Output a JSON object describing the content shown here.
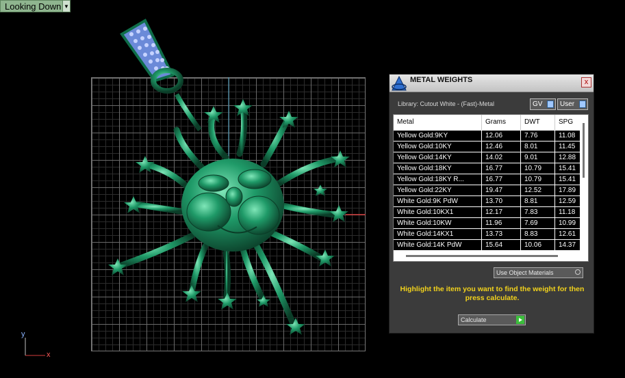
{
  "viewport": {
    "label": "Looking Down"
  },
  "gizmo": {
    "y": "y",
    "x": "x"
  },
  "panel": {
    "title": "METAL WEIGHTS",
    "close": "x",
    "library": "Library: Cutout White - (Fast)-Metal",
    "toggle_gv": "GV",
    "toggle_user": "User",
    "columns": [
      "Metal",
      "Grams",
      "DWT",
      "SPG"
    ],
    "rows": [
      [
        "Yellow Gold:9KY",
        "12.06",
        "7.76",
        "11.08"
      ],
      [
        "Yellow Gold:10KY",
        "12.46",
        "8.01",
        "11.45"
      ],
      [
        "Yellow Gold:14KY",
        "14.02",
        "9.01",
        "12.88"
      ],
      [
        "Yellow Gold:18KY",
        "16.77",
        "10.79",
        "15.41"
      ],
      [
        "Yellow Gold:18KY R...",
        "16.77",
        "10.79",
        "15.41"
      ],
      [
        "Yellow Gold:22KY",
        "19.47",
        "12.52",
        "17.89"
      ],
      [
        "White Gold:9K PdW",
        "13.70",
        "8.81",
        "12.59"
      ],
      [
        "White Gold:10KX1",
        "12.17",
        "7.83",
        "11.18"
      ],
      [
        "White Gold:10KW",
        "11.96",
        "7.69",
        "10.99"
      ],
      [
        "White Gold:14KX1",
        "13.73",
        "8.83",
        "12.61"
      ],
      [
        "White Gold:14K PdW",
        "15.64",
        "10.06",
        "14.37"
      ]
    ],
    "use_object_materials": "Use Object Materials",
    "hint": "Highlight the item you want to find the weight for then press calculate.",
    "calculate": "Calculate"
  },
  "colors": {
    "model": "#1e8a5e",
    "hint": "#f2d21c",
    "gem": "#8fa8ff"
  }
}
